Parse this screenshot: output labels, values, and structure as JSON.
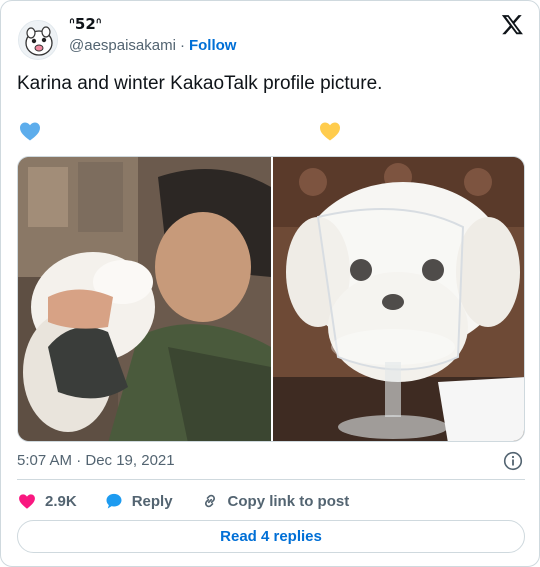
{
  "tweet": {
    "display_name": "ᐢ𝟱𝟮ᐢ",
    "handle": "@aespaisakami",
    "separator": "·",
    "follow_label": "Follow",
    "text": "Karina and winter KakaoTalk profile picture.",
    "timestamp": "5:07 AM · Dec 19, 2021"
  },
  "emoji": {
    "left_heart_color": "#5dadec",
    "right_heart_color": "#ffcc4d"
  },
  "actions": {
    "like_count": "2.9K",
    "reply_label": "Reply",
    "copy_link_label": "Copy link to post",
    "read_replies_label": "Read 4 replies"
  },
  "colors": {
    "accent": "#006fd6",
    "like": "#f91880",
    "muted": "#536471",
    "border": "#cfd9de"
  },
  "icons": [
    "x-logo-icon",
    "info-icon",
    "heart-icon",
    "reply-bubble-icon",
    "link-icon"
  ]
}
